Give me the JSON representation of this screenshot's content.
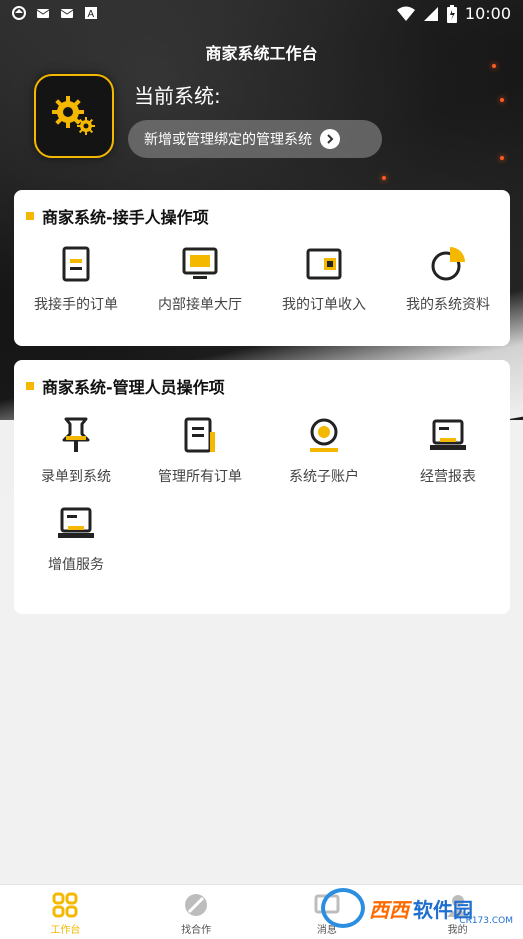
{
  "status_bar": {
    "time": "10:00"
  },
  "header": {
    "title": "商家系统工作台",
    "current_system_label": "当前系统:",
    "manage_button_label": "新增或管理绑定的管理系统"
  },
  "section_receiver": {
    "title": "商家系统-接手人操作项",
    "items": [
      {
        "label": "我接手的订单",
        "icon": "document-icon"
      },
      {
        "label": "内部接单大厅",
        "icon": "monitor-icon"
      },
      {
        "label": "我的订单收入",
        "icon": "wallet-icon"
      },
      {
        "label": "我的系统资料",
        "icon": "pie-chart-icon"
      }
    ]
  },
  "section_manager": {
    "title": "商家系统-管理人员操作项",
    "items": [
      {
        "label": "录单到系统",
        "icon": "pin-icon"
      },
      {
        "label": "管理所有订单",
        "icon": "orders-icon"
      },
      {
        "label": "系统子账户",
        "icon": "user-account-icon"
      },
      {
        "label": "经营报表",
        "icon": "laptop-report-icon"
      },
      {
        "label": "增值服务",
        "icon": "laptop-service-icon"
      }
    ]
  },
  "tabbar": {
    "tabs": [
      {
        "label": "工作台",
        "icon": "workbench-icon",
        "active": true
      },
      {
        "label": "找合作",
        "icon": "cooperate-icon",
        "active": false
      },
      {
        "label": "消息",
        "icon": "message-icon",
        "active": false
      },
      {
        "label": "我的",
        "icon": "profile-icon",
        "active": false
      }
    ]
  },
  "watermark": {
    "text_1": "西西",
    "text_2": "软件园",
    "domain": "CR173.COM"
  },
  "colors": {
    "accent": "#f5b800",
    "hero_dark": "#1a1a1a",
    "background": "#f1f1f1"
  }
}
